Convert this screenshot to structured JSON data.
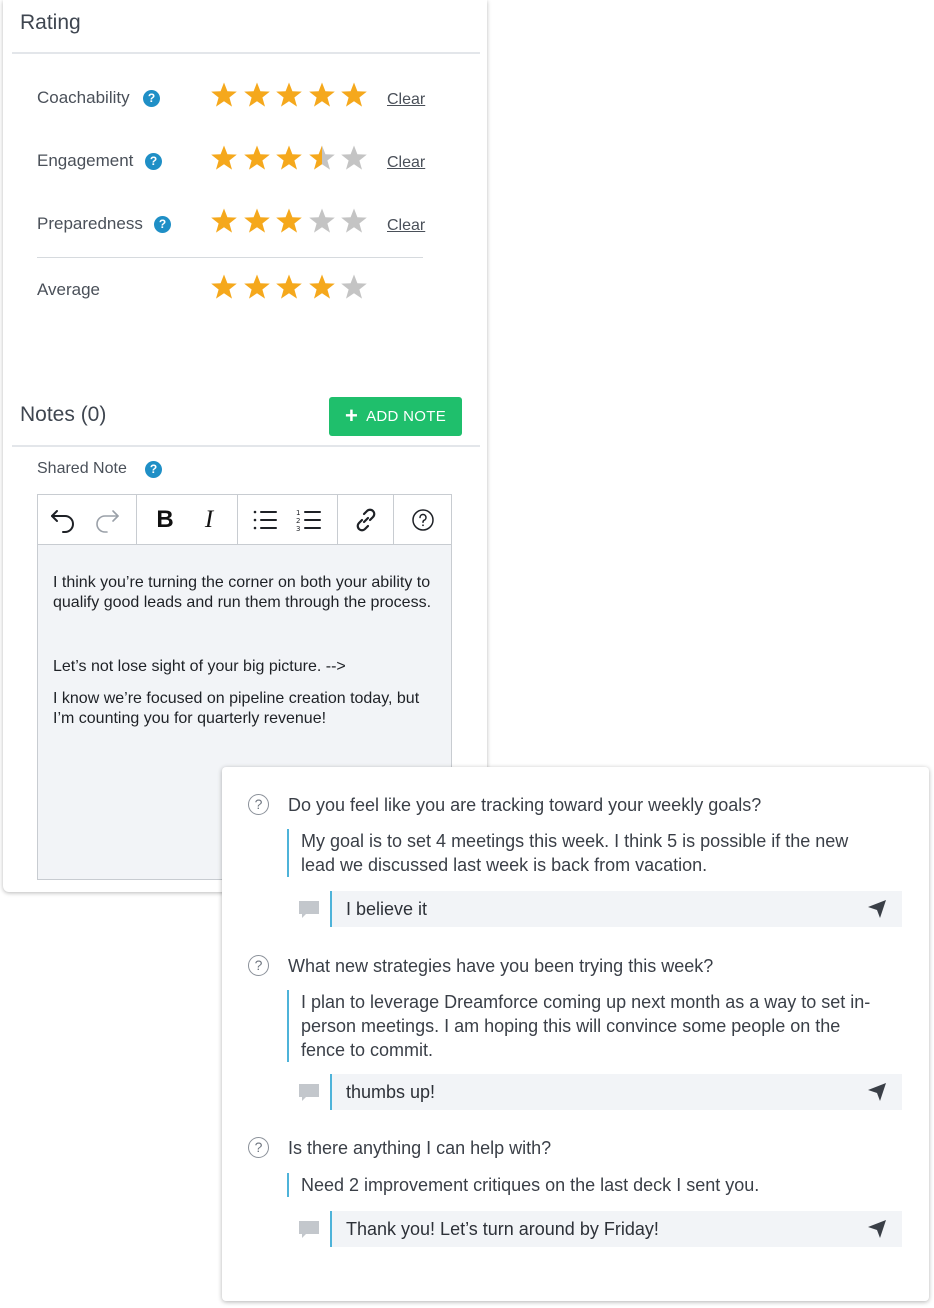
{
  "rating": {
    "title": "Rating",
    "rows": [
      {
        "label": "Coachability",
        "value": 5,
        "clear_label": "Clear"
      },
      {
        "label": "Engagement",
        "value": 3.5,
        "clear_label": "Clear"
      },
      {
        "label": "Preparedness",
        "value": 3,
        "clear_label": "Clear"
      }
    ],
    "average": {
      "label": "Average",
      "value": 4
    },
    "max_stars": 5,
    "colors": {
      "star_filled": "#f5a81c",
      "star_empty": "#c4c4c4",
      "info_badge": "#1f8fc6"
    }
  },
  "notes": {
    "title": "Notes (0)",
    "add_button_label": "ADD NOTE",
    "add_button_color": "#1fbf6c",
    "shared_label": "Shared Note",
    "toolbar": [
      "undo-icon",
      "redo-icon",
      "bold-icon",
      "italic-icon",
      "bullet-list-icon",
      "numbered-list-icon",
      "link-icon",
      "help-icon"
    ],
    "editor_paragraphs": [
      "I think you’re turning the corner on both your ability to qualify good leads and run them through the process.",
      "Let’s not lose sight of your big picture. -->",
      "I know we’re focused on pipeline creation today, but I’m counting you for quarterly revenue!"
    ]
  },
  "questions": [
    {
      "question": "Do you feel like you are tracking toward your weekly goals?",
      "answer": "My goal is to set 4 meetings this week. I think 5 is possible if the new lead we discussed last week is back from vacation.",
      "reply": "I believe it"
    },
    {
      "question": "What new strategies have you been trying this week?",
      "answer": "I plan to leverage Dreamforce coming up next month as a way to set in-person meetings. I am hoping this will convince some people on the fence to commit.",
      "reply": "thumbs up!"
    },
    {
      "question": "Is there anything I can help with?",
      "answer": "Need 2 improvement critiques on the last deck I sent you.",
      "reply": "Thank you! Let’s turn around by Friday!"
    }
  ]
}
